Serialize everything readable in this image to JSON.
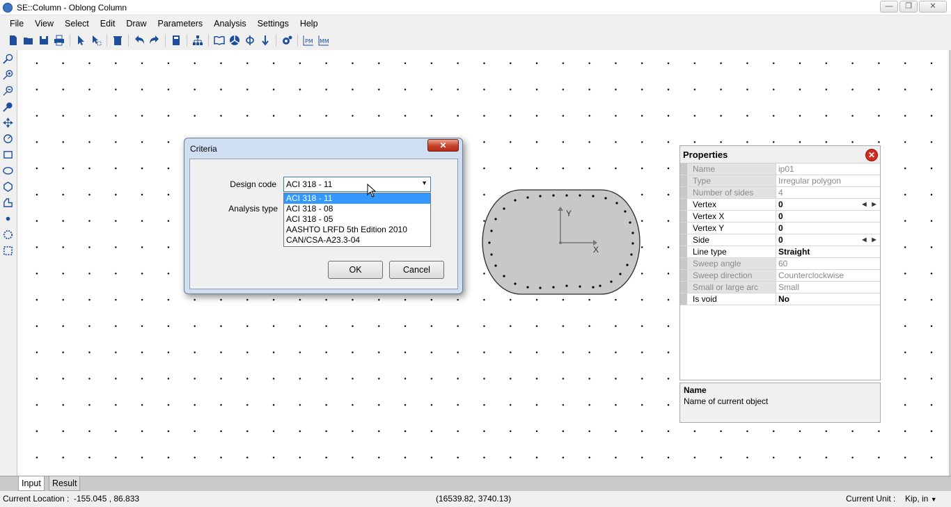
{
  "window": {
    "title": "SE::Column - Oblong Column",
    "minimize": "—",
    "maximize": "❐",
    "close": "✕"
  },
  "menu": [
    "File",
    "View",
    "Select",
    "Edit",
    "Draw",
    "Parameters",
    "Analysis",
    "Settings",
    "Help"
  ],
  "toolbar_labels": {
    "pm": "PM",
    "mm": "MM"
  },
  "section": {
    "axis_x": "X",
    "axis_y": "Y"
  },
  "dialog": {
    "title": "Criteria",
    "close_label": "✕",
    "design_code_label": "Design code",
    "analysis_type_label": "Analysis type",
    "design_code_value": "ACI 318 - 11",
    "design_code_options": [
      "ACI 318 - 11",
      "ACI 318 - 08",
      "ACI 318 - 05",
      "AASHTO LRFD 5th Edition 2010",
      "CAN/CSA-A23.3-04"
    ],
    "ok_label": "OK",
    "cancel_label": "Cancel"
  },
  "properties": {
    "title": "Properties",
    "close_label": "✕",
    "rows": [
      {
        "key": "Name",
        "value": "ip01"
      },
      {
        "key": "Type",
        "value": "Irregular polygon"
      },
      {
        "key": "Number of sides",
        "value": "4"
      },
      {
        "key": "Vertex",
        "value": "0"
      },
      {
        "key": "Vertex X",
        "value": "0"
      },
      {
        "key": "Vertex Y",
        "value": "0"
      },
      {
        "key": "Side",
        "value": "0"
      },
      {
        "key": "Line type",
        "value": "Straight"
      },
      {
        "key": "Sweep angle",
        "value": "60"
      },
      {
        "key": "Sweep direction",
        "value": "Counterclockwise"
      },
      {
        "key": "Small or large arc",
        "value": "Small"
      },
      {
        "key": "Is void",
        "value": "No"
      }
    ],
    "description_title": "Name",
    "description_text": "Name of current object"
  },
  "tabs": {
    "input": "Input",
    "result": "Result"
  },
  "status": {
    "location_label": "Current Location :",
    "location_value": "-155.045 , 86.833",
    "coords": "(16539.82, 3740.13)",
    "unit_label": "Current Unit :",
    "unit_value": "Kip, in"
  }
}
